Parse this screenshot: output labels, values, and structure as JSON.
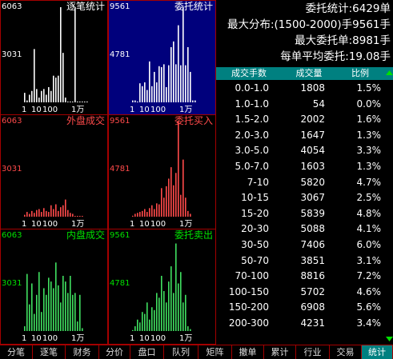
{
  "colors": {
    "white": "#ffffff",
    "red": "#ff4a4a",
    "green": "#00e000",
    "teal": "#008080",
    "border": "#a40000"
  },
  "panels": [
    {
      "id": "tick-stats",
      "title": "逐笔统计",
      "ymax": "6063",
      "ymid": "3031",
      "color": "#ffffff",
      "labelColor": "#ffffff",
      "selected": false,
      "xticks": [
        "1",
        "10",
        "100",
        "1万"
      ],
      "bars": [
        10,
        2,
        8,
        12,
        56,
        14,
        5,
        12,
        14,
        8,
        16,
        12,
        28,
        26,
        28,
        100,
        52,
        5,
        0.5,
        0.5,
        0.5,
        100,
        0.5,
        0.5,
        0.5,
        0.5,
        0.5
      ]
    },
    {
      "id": "order-stats",
      "title": "委托统计",
      "ymax": "9561",
      "ymid": "4781",
      "color": "#ffffff",
      "labelColor": "#ffffff",
      "selected": true,
      "xticks": [
        "1",
        "10",
        "100",
        "1万"
      ],
      "bars": [
        2,
        2,
        0.6,
        20,
        17,
        21,
        13,
        43,
        17,
        32,
        21,
        38,
        37,
        40,
        16,
        39,
        58,
        64,
        40,
        81,
        39,
        100,
        39,
        58,
        32,
        2,
        2
      ]
    },
    {
      "id": "outer-volume",
      "title": "外盘成交",
      "ymax": "6063",
      "ymid": "3031",
      "color": "#ff4a4a",
      "labelColor": "#ff4a4a",
      "selected": false,
      "xticks": [
        "1",
        "10",
        "100",
        "1万"
      ],
      "bars": [
        2,
        5,
        3,
        6,
        4,
        7,
        8,
        5,
        9,
        6,
        5,
        12,
        8,
        13,
        6,
        10,
        12,
        18,
        7,
        4,
        3,
        0.5,
        0.5,
        0.5,
        0.5
      ]
    },
    {
      "id": "order-buy",
      "title": "委托买入",
      "ymax": "9561",
      "ymid": "4781",
      "color": "#ff4a4a",
      "labelColor": "#ff4a4a",
      "selected": false,
      "xticks": [
        "1",
        "10",
        "100",
        "1万"
      ],
      "bars": [
        1,
        3,
        4,
        5,
        6,
        8,
        5,
        9,
        12,
        8,
        14,
        13,
        30,
        20,
        32,
        40,
        52,
        33,
        46,
        100,
        23,
        60,
        20,
        6,
        3
      ]
    },
    {
      "id": "inner-volume",
      "title": "内盘成交",
      "ymax": "6063",
      "ymid": "3031",
      "color": "#40e060",
      "labelColor": "#00e000",
      "selected": false,
      "xticks": [
        "1",
        "10",
        "100",
        "1万"
      ],
      "bars": [
        5,
        60,
        28,
        50,
        18,
        38,
        62,
        20,
        45,
        38,
        56,
        52,
        45,
        72,
        48,
        30,
        58,
        52,
        40,
        58,
        38,
        40,
        10,
        38,
        3
      ]
    },
    {
      "id": "order-sell",
      "title": "委托卖出",
      "ymax": "9561",
      "ymid": "4781",
      "color": "#40e060",
      "labelColor": "#00e000",
      "selected": false,
      "xticks": [
        "1",
        "10",
        "100",
        "1万"
      ],
      "bars": [
        1,
        5,
        12,
        9,
        20,
        18,
        30,
        12,
        25,
        22,
        40,
        35,
        58,
        42,
        30,
        52,
        68,
        40,
        92,
        50,
        62,
        30,
        38,
        5,
        2
      ]
    }
  ],
  "stats": {
    "order_count": "委托统计:6429单",
    "max_distribution": "最大分布:(1500-2000)手9561手",
    "max_order": "最大委托单:8981手",
    "avg_order": "每单平均委托:19.08手"
  },
  "table": {
    "headers": [
      "成交手数",
      "成交量",
      "比例"
    ],
    "rows": [
      [
        "0.0-1.0",
        "1808",
        "1.5%"
      ],
      [
        "1.0-1.0",
        "54",
        "0.0%"
      ],
      [
        "1.5-2.0",
        "2002",
        "1.6%"
      ],
      [
        "2.0-3.0",
        "1647",
        "1.3%"
      ],
      [
        "3.0-5.0",
        "4054",
        "3.3%"
      ],
      [
        "5.0-7.0",
        "1603",
        "1.3%"
      ],
      [
        "7-10",
        "5820",
        "4.7%"
      ],
      [
        "10-15",
        "3067",
        "2.5%"
      ],
      [
        "15-20",
        "5839",
        "4.8%"
      ],
      [
        "20-30",
        "5088",
        "4.1%"
      ],
      [
        "30-50",
        "7406",
        "6.0%"
      ],
      [
        "50-70",
        "3851",
        "3.1%"
      ],
      [
        "70-100",
        "8816",
        "7.2%"
      ],
      [
        "100-150",
        "5702",
        "4.6%"
      ],
      [
        "150-200",
        "6908",
        "5.6%"
      ],
      [
        "200-300",
        "4231",
        "3.4%"
      ]
    ]
  },
  "tabs": [
    "分笔",
    "逐笔",
    "财务",
    "分价",
    "盘口",
    "队列",
    "矩阵",
    "撤单",
    "累计",
    "行业",
    "交易",
    "统计"
  ],
  "active_tab": 11
}
